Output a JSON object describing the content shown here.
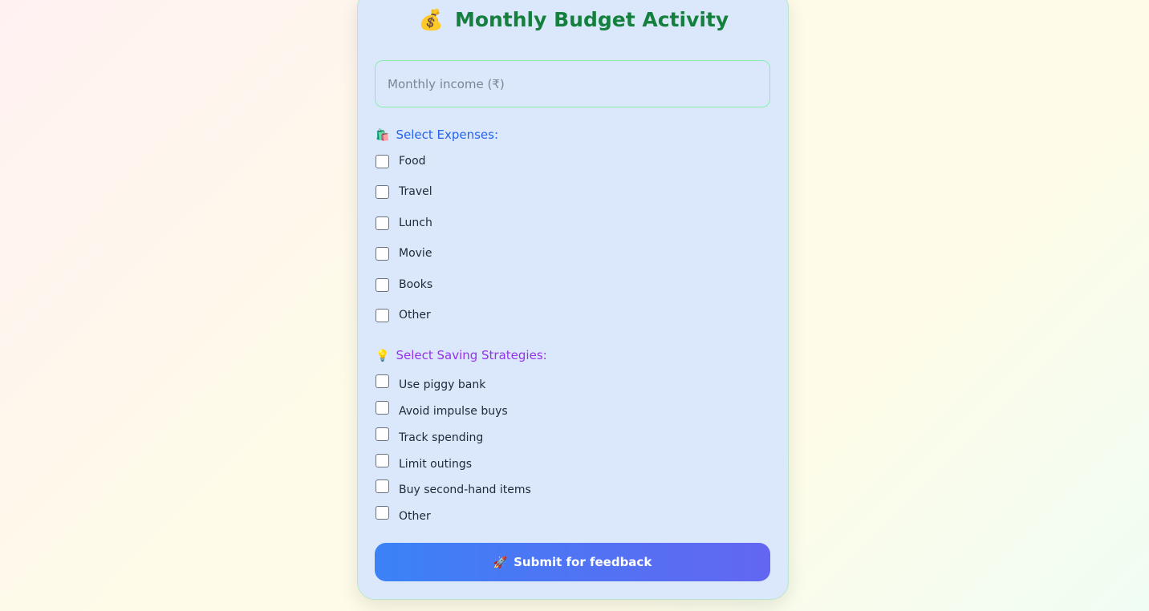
{
  "header": {
    "title_icon": "money-bag-icon",
    "title_emoji": "💰",
    "title": "Monthly Budget Activity"
  },
  "income": {
    "placeholder": "Monthly income (₹)",
    "value": ""
  },
  "expenses": {
    "icon": "shopping-bags-icon",
    "emoji": "🛍️",
    "title": "Select Expenses:",
    "title_color": "#2563eb",
    "options": [
      {
        "label": "Food",
        "checked": false
      },
      {
        "label": "Travel",
        "checked": false
      },
      {
        "label": "Lunch",
        "checked": false
      },
      {
        "label": "Movie",
        "checked": false
      },
      {
        "label": "Books",
        "checked": false
      },
      {
        "label": "Other",
        "checked": false
      }
    ]
  },
  "savings": {
    "icon": "light-bulb-icon",
    "emoji": "💡",
    "title": "Select Saving Strategies:",
    "title_color": "#9333ea",
    "options": [
      {
        "label": "Use piggy bank",
        "checked": false
      },
      {
        "label": "Avoid impulse buys",
        "checked": false
      },
      {
        "label": "Track spending",
        "checked": false
      },
      {
        "label": "Limit outings",
        "checked": false
      },
      {
        "label": "Buy second-hand items",
        "checked": false
      },
      {
        "label": "Other",
        "checked": false
      }
    ]
  },
  "submit": {
    "icon": "rocket-icon",
    "emoji": "🚀",
    "label": "Submit for feedback"
  },
  "colors": {
    "title_green": "#15803d",
    "card_background": "#dbe8fc",
    "button_gradient_start": "#3b82f6",
    "button_gradient_end": "#6366f1"
  }
}
